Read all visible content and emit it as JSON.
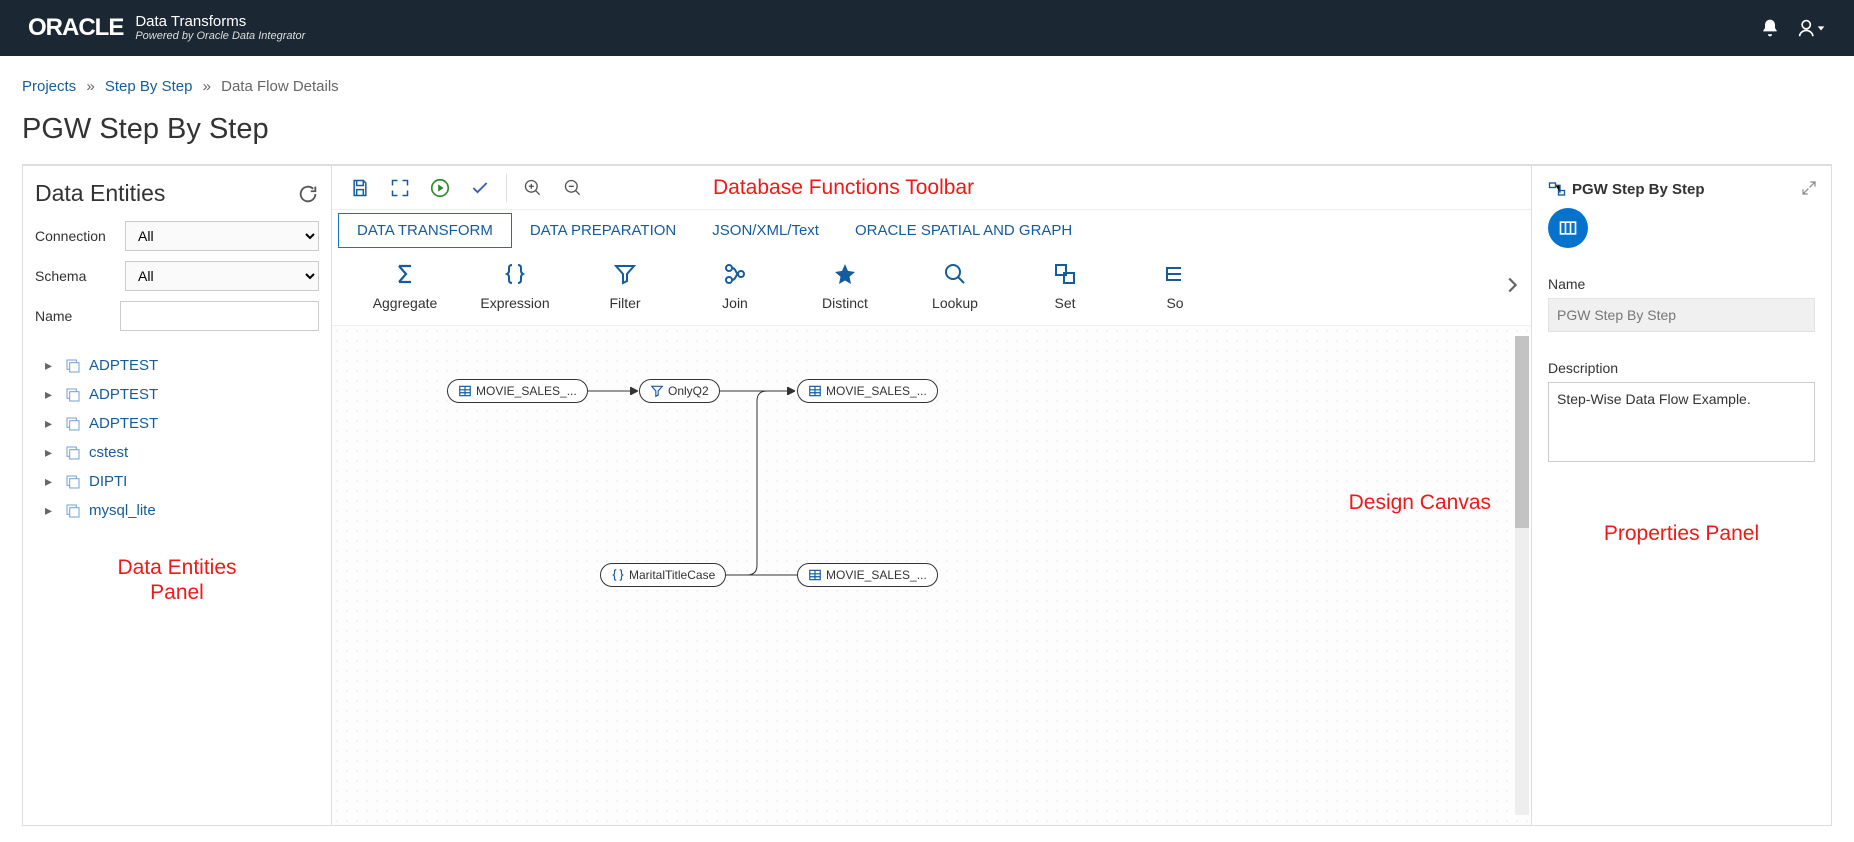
{
  "header": {
    "logo_text": "ORACLE",
    "app_title": "Data Transforms",
    "app_subtitle": "Powered by Oracle Data Integrator"
  },
  "breadcrumb": {
    "projects": "Projects",
    "step_by_step": "Step By Step",
    "current": "Data Flow Details"
  },
  "page_title": "PGW Step By Step",
  "left": {
    "panel_title": "Data Entities",
    "labels": {
      "connection": "Connection",
      "schema": "Schema",
      "name": "Name"
    },
    "connection_value": "All",
    "schema_value": "All",
    "name_value": "",
    "tree": [
      "ADPTEST",
      "ADPTEST",
      "ADPTEST",
      "cstest",
      "DIPTI",
      "mysql_lite"
    ],
    "annotation": "Data Entities\nPanel"
  },
  "center": {
    "tabs": [
      "DATA TRANSFORM",
      "DATA PREPARATION",
      "JSON/XML/Text",
      "ORACLE SPATIAL AND GRAPH"
    ],
    "funcs": [
      "Aggregate",
      "Expression",
      "Filter",
      "Join",
      "Distinct",
      "Lookup",
      "Set",
      "Sort"
    ],
    "funcs_icons": [
      "sigma",
      "braces",
      "funnel",
      "branch",
      "star",
      "search",
      "set",
      "list"
    ],
    "nodes": {
      "n1": "MOVIE_SALES_...",
      "n2": "OnlyQ2",
      "n3": "MOVIE_SALES_...",
      "n4": "MaritalTitleCase",
      "n5": "MOVIE_SALES_..."
    },
    "annot_toolbar": "Database Functions Toolbar",
    "annot_canvas": "Design Canvas"
  },
  "right": {
    "header": "PGW Step By Step",
    "name_label": "Name",
    "name_value": "PGW Step By Step",
    "desc_label": "Description",
    "desc_value": "Step-Wise Data Flow Example.",
    "annotation": "Properties Panel"
  }
}
